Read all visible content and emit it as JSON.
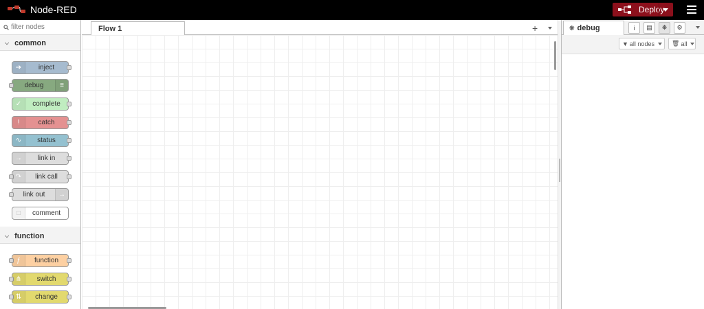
{
  "header": {
    "title": "Node-RED",
    "deploy_label": "Deploy"
  },
  "palette": {
    "filter_placeholder": "filter nodes",
    "categories": [
      {
        "name": "common",
        "nodes": [
          {
            "label": "inject",
            "color": "#a6bbcf"
          },
          {
            "label": "debug",
            "color": "#87a980"
          },
          {
            "label": "complete",
            "color": "#c0edc0"
          },
          {
            "label": "catch",
            "color": "#e49191"
          },
          {
            "label": "status",
            "color": "#94c1d0"
          },
          {
            "label": "link in",
            "color": "#dddddd"
          },
          {
            "label": "link call",
            "color": "#dddddd"
          },
          {
            "label": "link out",
            "color": "#dddddd"
          },
          {
            "label": "comment",
            "color": "#ffffff"
          }
        ]
      },
      {
        "name": "function",
        "nodes": [
          {
            "label": "function",
            "color": "#fdd0a2"
          },
          {
            "label": "switch",
            "color": "#e2d96e"
          },
          {
            "label": "change",
            "color": "#e2d96e"
          }
        ]
      }
    ]
  },
  "workspace": {
    "tabs": [
      {
        "label": "Flow 1"
      }
    ],
    "add_icon": "+"
  },
  "sidebar": {
    "active_tab": "debug",
    "filter_nodes_label": "all nodes",
    "clear_label": "all"
  },
  "colors": {
    "header_bg": "#000000",
    "deploy_bg": "#8c101c"
  }
}
